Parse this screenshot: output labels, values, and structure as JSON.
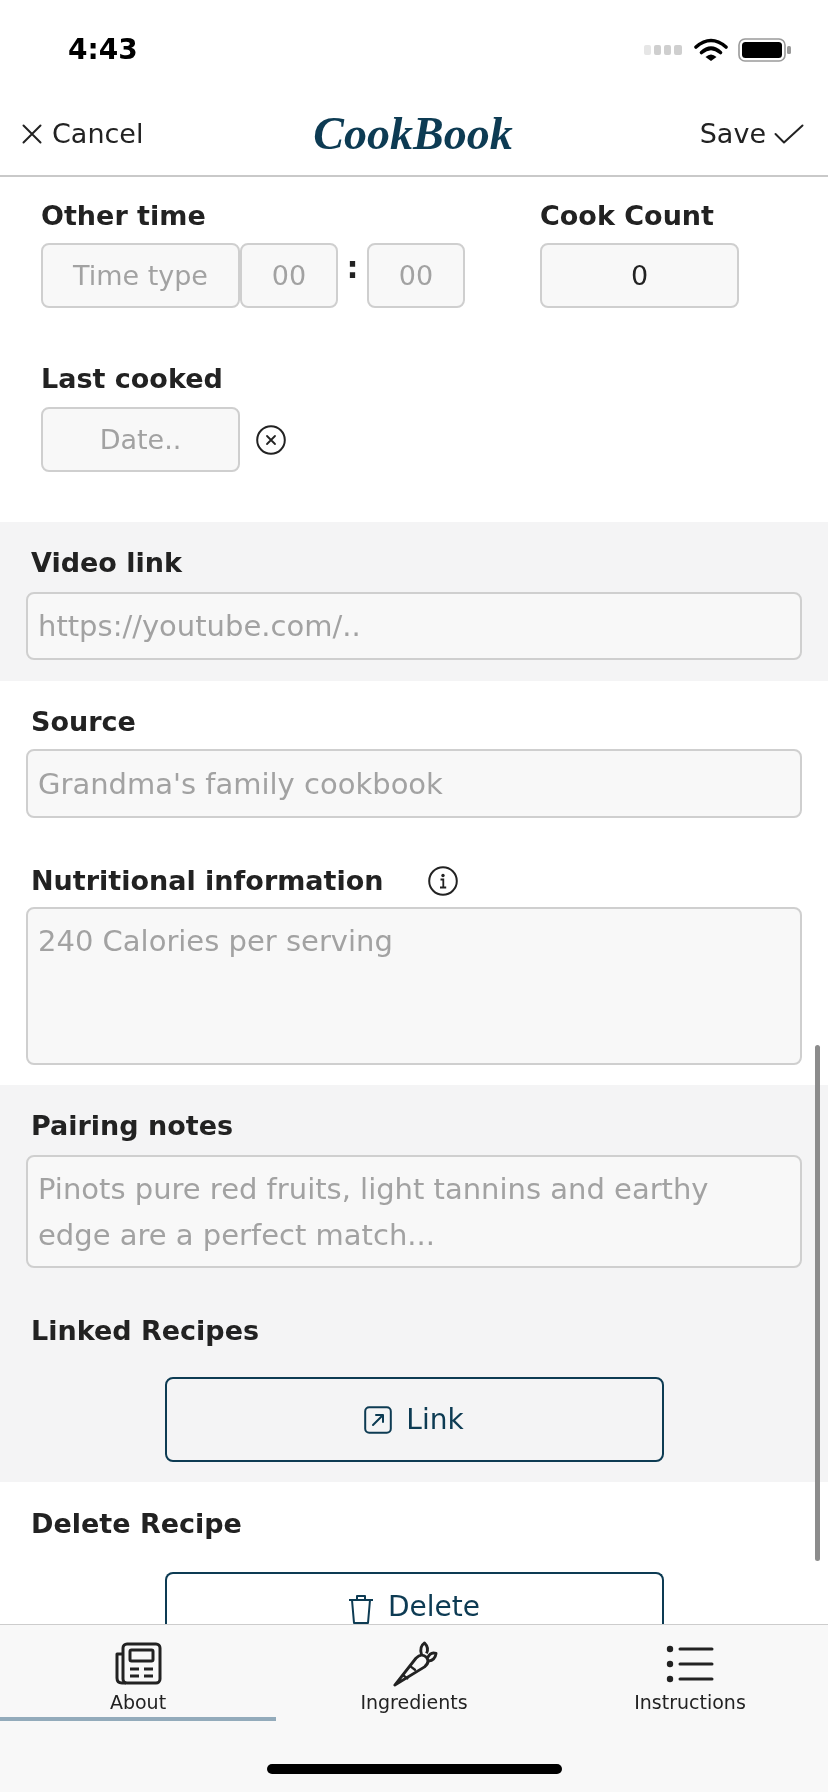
{
  "status_bar": {
    "time": "4:43"
  },
  "header": {
    "cancel": "Cancel",
    "logo": "CookBook",
    "save": "Save"
  },
  "other_time": {
    "label": "Other time",
    "type_placeholder": "Time type",
    "hours_placeholder": "00",
    "separator": ":",
    "minutes_placeholder": "00"
  },
  "cook_count": {
    "label": "Cook Count",
    "value": "0"
  },
  "last_cooked": {
    "label": "Last cooked",
    "placeholder": "Date.."
  },
  "video_link": {
    "label": "Video link",
    "placeholder": "https://youtube.com/.."
  },
  "source": {
    "label": "Source",
    "placeholder": "Grandma's family cookbook"
  },
  "nutritional_information": {
    "label": "Nutritional information",
    "placeholder": "240 Calories per serving"
  },
  "pairing_notes": {
    "label": "Pairing notes",
    "placeholder": "Pinots pure red fruits, light tannins and earthy edge are a perfect match..."
  },
  "linked_recipes": {
    "label": "Linked Recipes",
    "button": "Link"
  },
  "delete_recipe": {
    "label": "Delete Recipe",
    "button": "Delete"
  },
  "tabs": [
    {
      "label": "About",
      "selected": true
    },
    {
      "label": "Ingredients",
      "selected": false
    },
    {
      "label": "Instructions",
      "selected": false
    }
  ]
}
